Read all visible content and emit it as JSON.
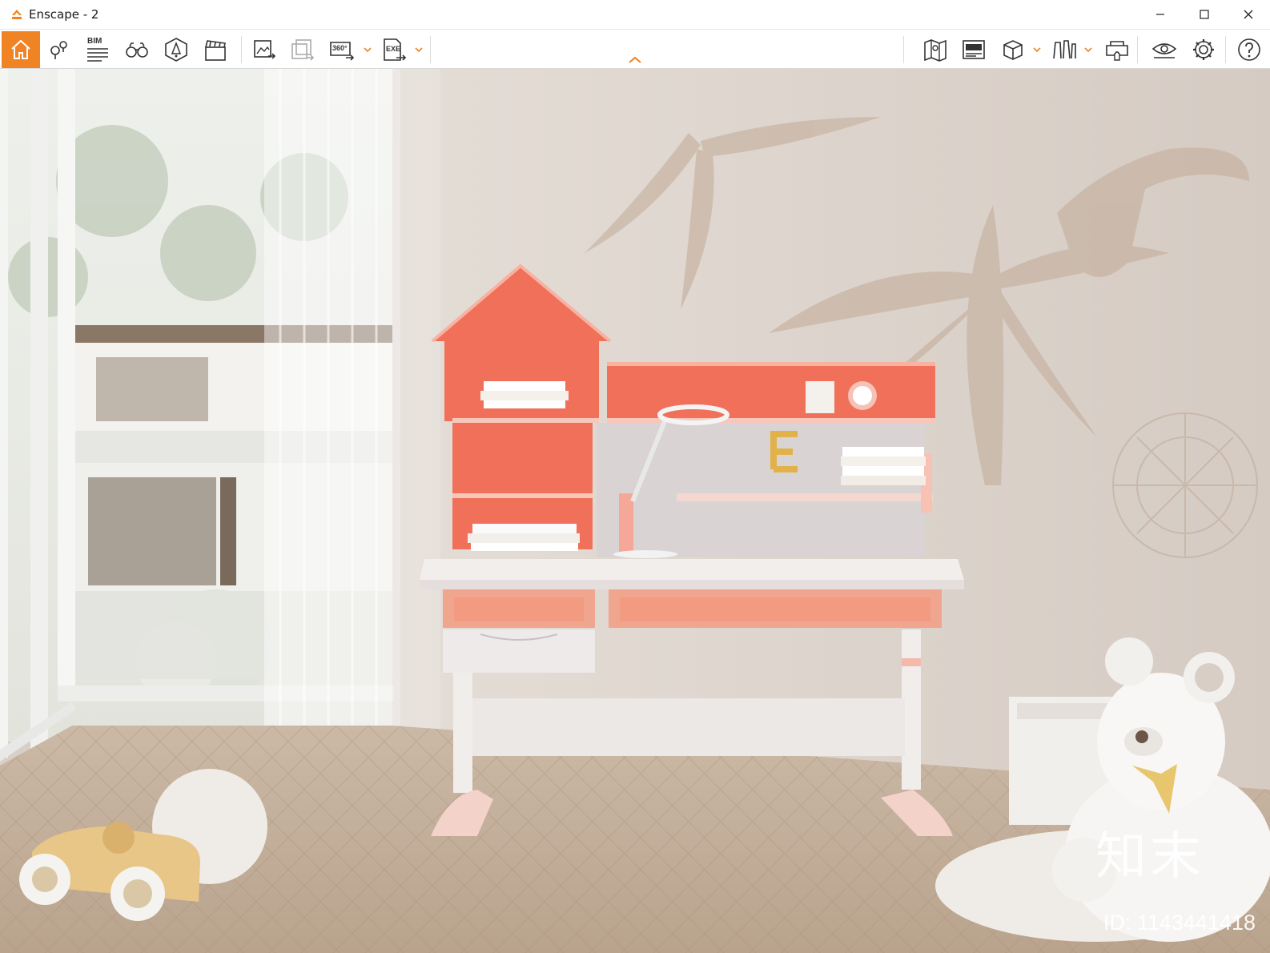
{
  "window": {
    "title": "Enscape - 2"
  },
  "colors": {
    "accent": "#f08324",
    "desk_orange": "#f0705a",
    "toolbar_icon": "#3a3a3a"
  },
  "toolbar": {
    "left_icons": [
      "home-icon",
      "location-pins-icon",
      "bim-list-icon",
      "binoculars-icon",
      "asset-library-icon",
      "clapperboard-icon",
      "export-image-icon",
      "batch-export-icon",
      "panorama-360-icon",
      "exe-export-icon"
    ],
    "right_icons": [
      "map-icon",
      "visual-settings-panel-icon",
      "material-cube-icon",
      "views-icon",
      "vr-headset-icon",
      "eye-icon",
      "gear-icon",
      "help-icon"
    ],
    "bim_label": "BIM",
    "pano_label": "360°",
    "exe_label": "EXE"
  },
  "watermark": {
    "logo_text": "知末",
    "id_text": "ID: 1143441418"
  }
}
